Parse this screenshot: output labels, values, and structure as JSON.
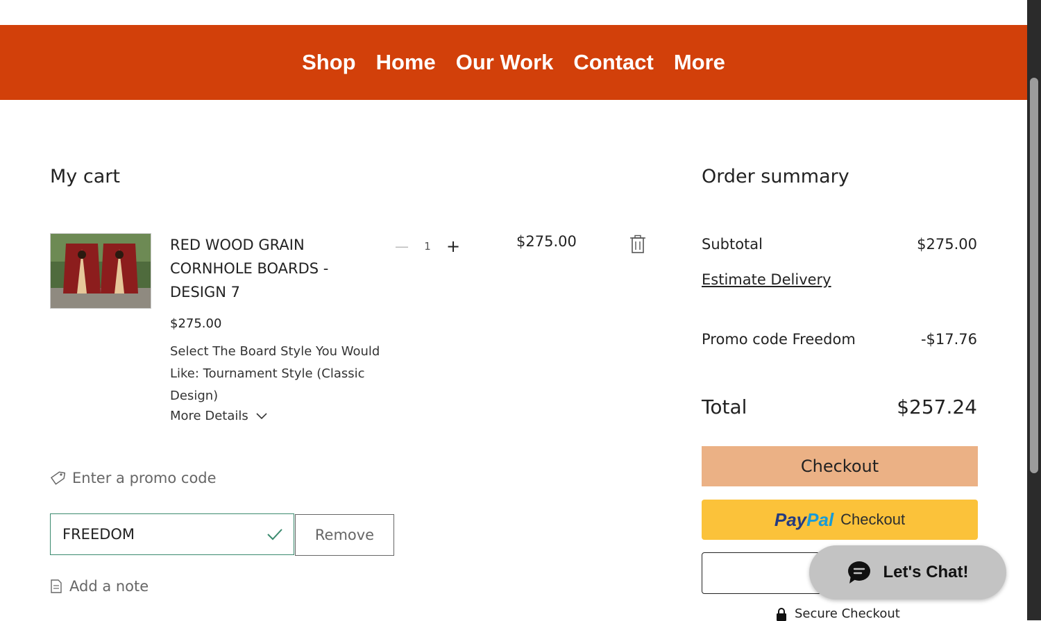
{
  "nav": {
    "items": [
      "Shop",
      "Home",
      "Our Work",
      "Contact",
      "More"
    ]
  },
  "cart": {
    "title": "My cart",
    "item": {
      "name": "RED WOOD GRAIN CORNHOLE BOARDS - DESIGN 7",
      "price": "$275.00",
      "option": "Select The Board Style You Would Like: Tournament Style (Classic Design)",
      "more_details": "More Details",
      "quantity": "1",
      "line_total": "$275.00"
    },
    "promo": {
      "toggle_label": "Enter a promo code",
      "value": "FREEDOM",
      "remove_label": "Remove"
    },
    "note_label": "Add a note"
  },
  "summary": {
    "title": "Order summary",
    "subtotal_label": "Subtotal",
    "subtotal_value": "$275.00",
    "estimate_delivery": "Estimate Delivery",
    "promo_label": "Promo code Freedom",
    "promo_value": "-$17.76",
    "total_label": "Total",
    "total_value": "$257.24",
    "checkout_label": "Checkout",
    "paypal": {
      "logo_a": "Pay",
      "logo_b": "Pal",
      "label": "Checkout"
    },
    "secure_label": "Secure Checkout"
  },
  "chat": {
    "label": "Let's Chat!"
  },
  "colors": {
    "nav_bg": "#d2400a",
    "checkout_bg": "#ebb185",
    "paypal_bg": "#fbc23a",
    "promo_border": "#3a8a6e",
    "chat_bg": "#c3c3c3"
  },
  "icons": {
    "trash": "trash-icon",
    "tag": "tag-icon",
    "check": "check-icon",
    "note": "note-icon",
    "chevron": "chevron-down-icon",
    "lock": "lock-icon",
    "chat": "chat-bubble-icon"
  }
}
